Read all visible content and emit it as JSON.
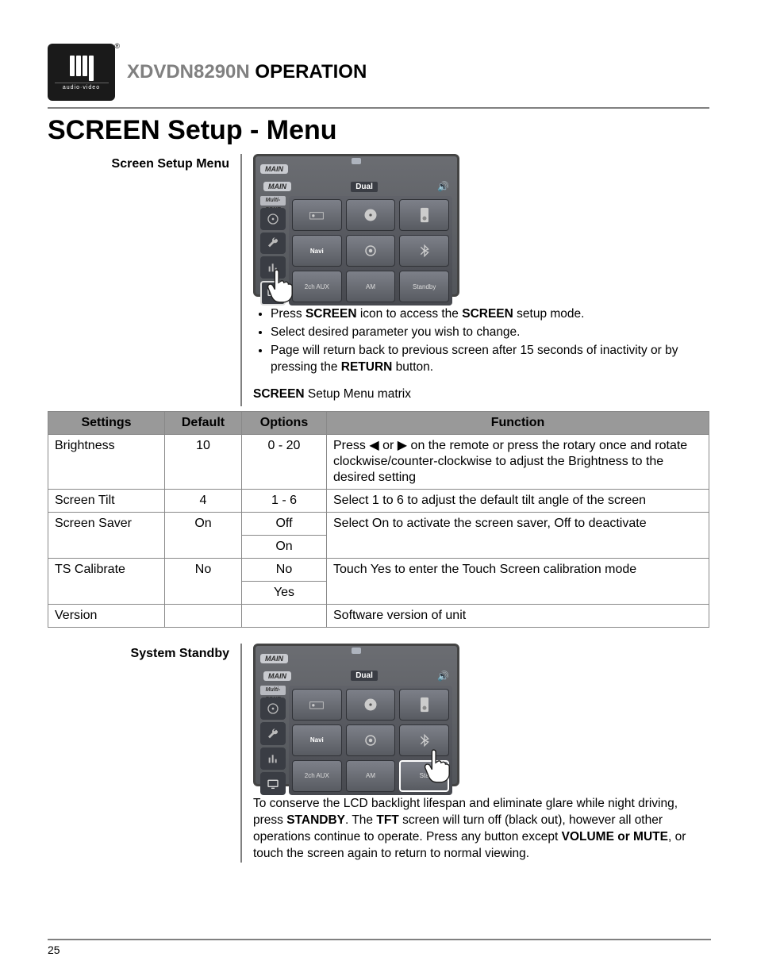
{
  "logo": {
    "brand": "Dual",
    "sub": "audio·video"
  },
  "header": {
    "model": "XDVDN8290N",
    "suffix": "OPERATION"
  },
  "title": "SCREEN Setup - Menu",
  "section1": {
    "label": "Screen Setup Menu"
  },
  "device": {
    "main": "MAIN",
    "brand": "Dual",
    "multizone": "Multi-ZONE",
    "navi": "Navi",
    "standby": "Standby",
    "am": "AM",
    "aux": "2ch AUX"
  },
  "instructions": {
    "i1a": "Press ",
    "i1b": "SCREEN",
    "i1c": " icon to access the ",
    "i1d": "SCREEN",
    "i1e": " setup mode.",
    "i2": "Select desired parameter you wish to change.",
    "i3a": "Page will return back to previous screen after 15 seconds of inactivity or by pressing the ",
    "i3b": "RETURN",
    "i3c": " button."
  },
  "subhead": {
    "b": "SCREEN",
    "rest": " Setup Menu matrix"
  },
  "table": {
    "headers": {
      "settings": "Settings",
      "default": "Default",
      "options": "Options",
      "function": "Function"
    },
    "rows": {
      "r0": {
        "setting": "Brightness",
        "default": "10",
        "option": "0 - 20",
        "fn_a": "Press ",
        "fn_b": " or ",
        "fn_c": " on the remote or press the rotary once and rotate clockwise/counter-clockwise to adjust the Brightness to the desired setting"
      },
      "r1": {
        "setting": "Screen Tilt",
        "default": "4",
        "option": "1 - 6",
        "fn": "Select 1 to 6 to adjust the default tilt angle of the screen"
      },
      "r2": {
        "setting": "Screen Saver",
        "default": "On",
        "opt1": "Off",
        "opt2": "On",
        "fn": "Select On to activate the screen saver, Off to deactivate"
      },
      "r3": {
        "setting": "TS Calibrate",
        "default": "No",
        "opt1": "No",
        "opt2": "Yes",
        "fn": "Touch Yes to enter the Touch Screen calibration mode"
      },
      "r4": {
        "setting": "Version",
        "fn": "Software version of unit"
      }
    }
  },
  "section2": {
    "label": "System Standby",
    "desc_a": "To conserve the LCD backlight lifespan and eliminate glare while night driving, press ",
    "desc_b": "STANDBY",
    "desc_c": ". The ",
    "desc_d": "TFT",
    "desc_e": " screen will turn off (black out), however all other operations continue to operate. Press any button except ",
    "desc_f": "VOLUME or MUTE",
    "desc_g": ", or touch the screen again to return to normal viewing."
  },
  "pagenum": "25"
}
